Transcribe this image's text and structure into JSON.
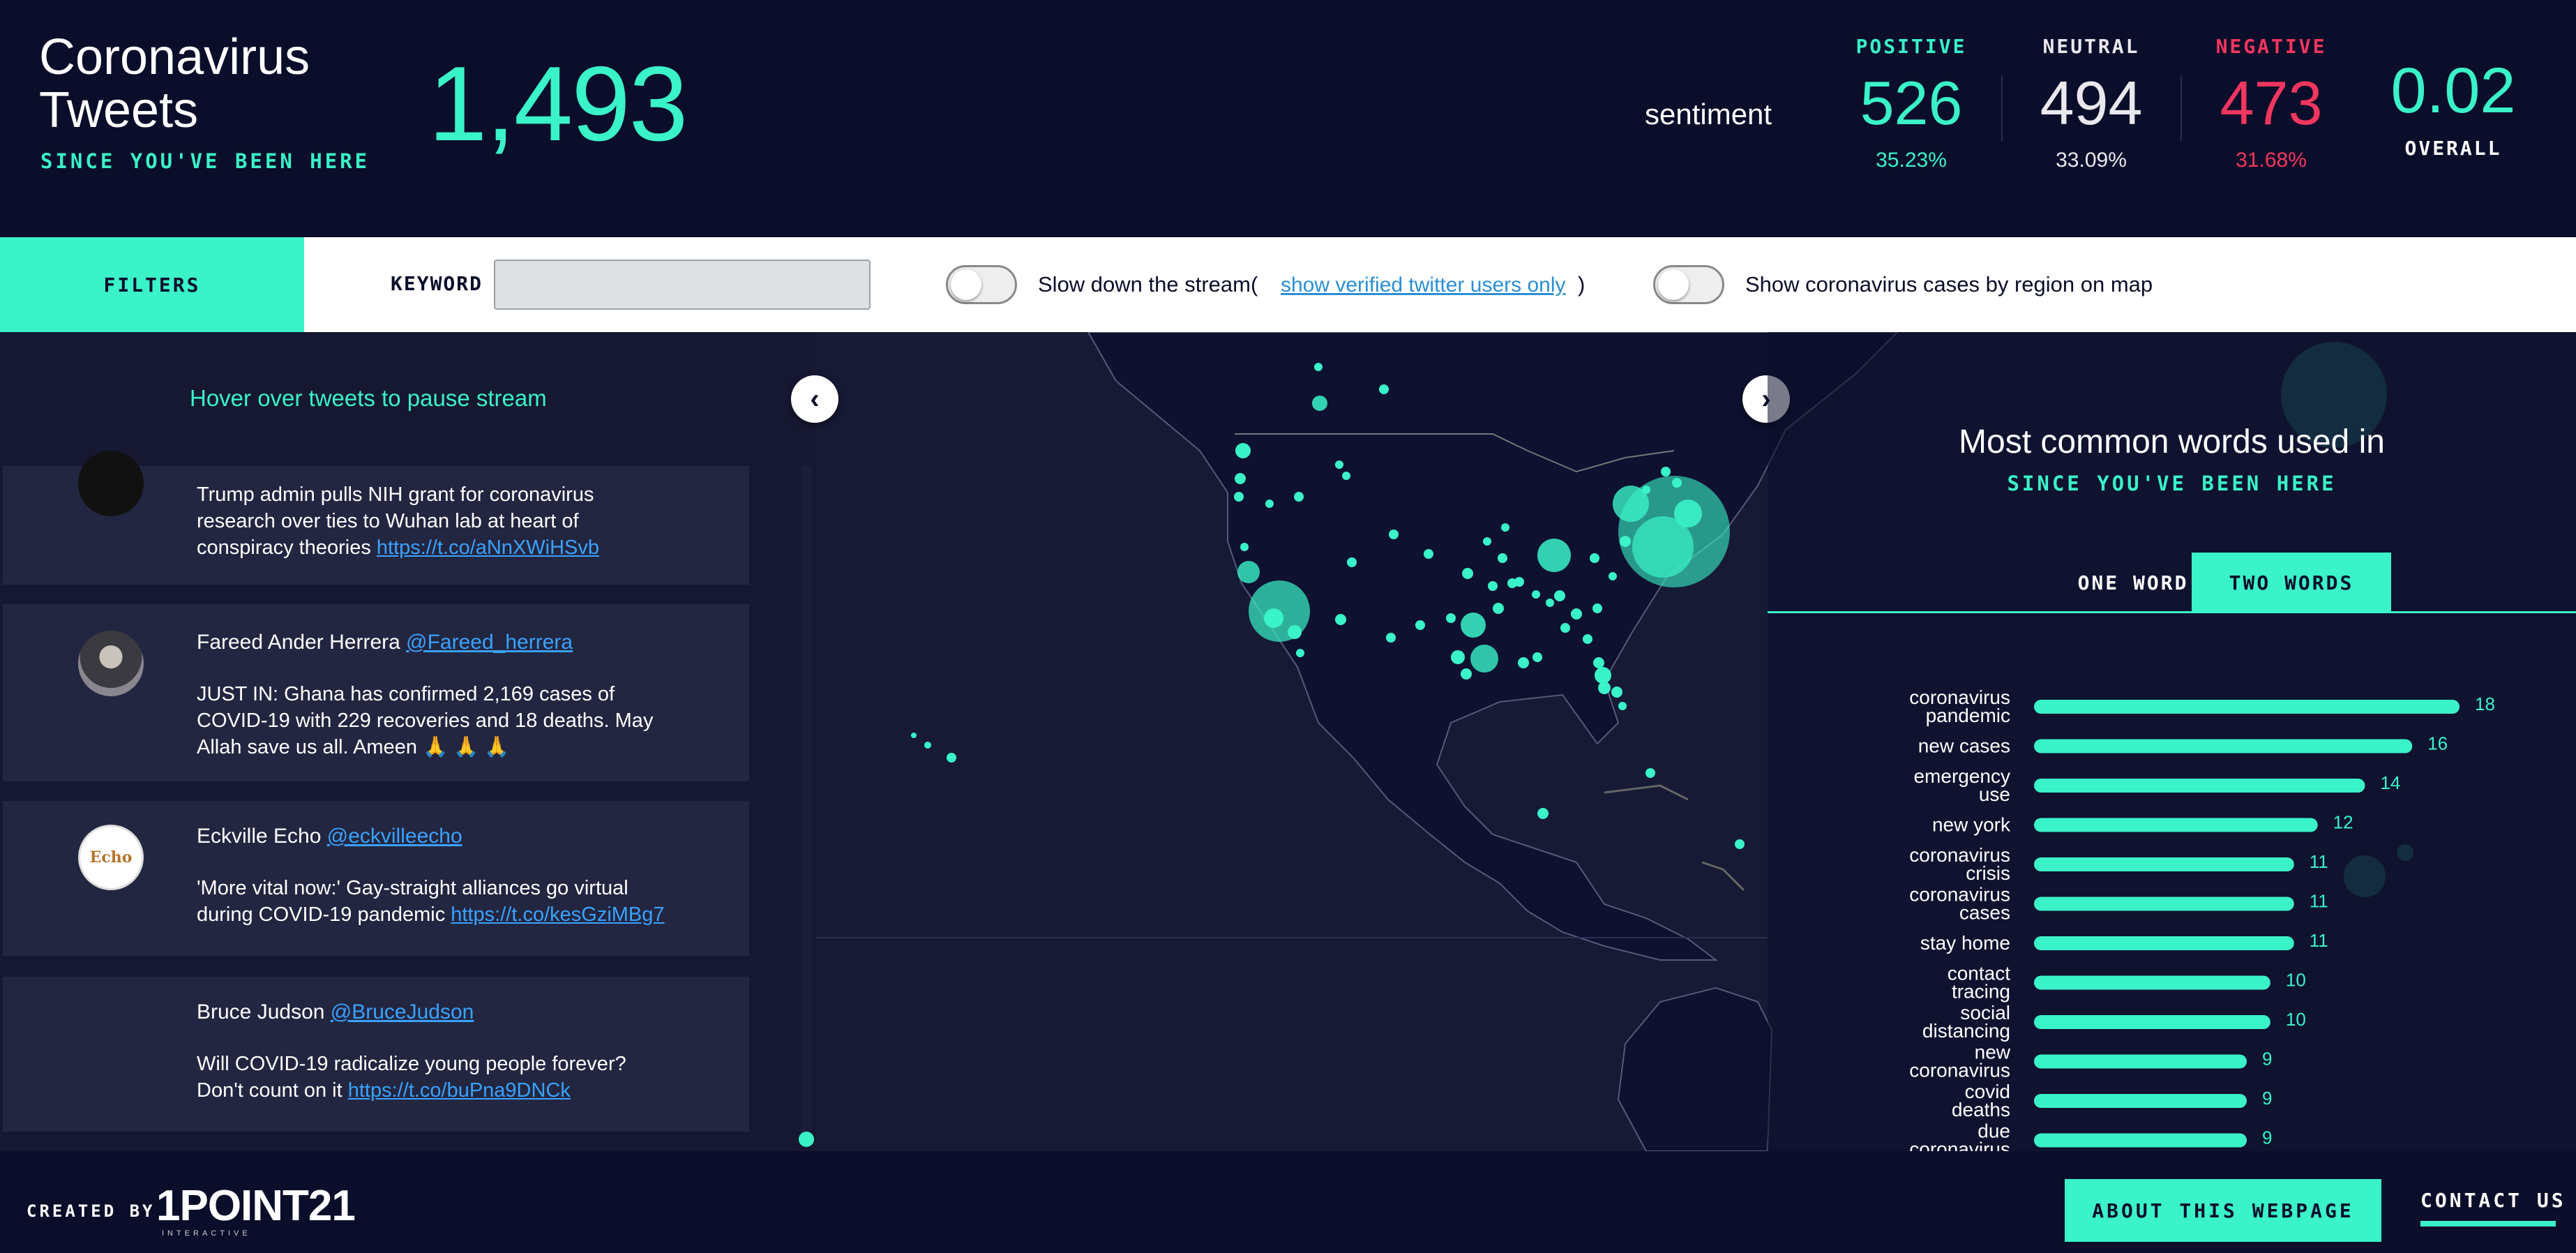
{
  "header": {
    "title": "Coronavirus Tweets",
    "subtitle": "SINCE YOU'VE BEEN HERE",
    "tweet_count": "1,493",
    "sentiment_label": "sentiment",
    "positive": {
      "label": "POSITIVE",
      "count": "526",
      "percent": "35.23%"
    },
    "neutral": {
      "label": "NEUTRAL",
      "count": "494",
      "percent": "33.09%"
    },
    "negative": {
      "label": "NEGATIVE",
      "count": "473",
      "percent": "31.68%"
    },
    "overall": {
      "value": "0.02",
      "label": "OVERALL"
    }
  },
  "filters": {
    "button_label": "FILTERS",
    "keyword_label": "KEYWORD",
    "keyword_value": "",
    "slow_label": "Slow down the stream(",
    "verified_link": "show verified twitter users only",
    "paren_close": ")",
    "cases_label": "Show coronavirus cases by region on map",
    "slow_enabled": false,
    "cases_enabled": false
  },
  "tweets": {
    "hint": "Hover over tweets to pause stream",
    "items": [
      {
        "author": "",
        "handle": "",
        "text": "Trump admin pulls NIH grant for coronavirus research over ties to Wuhan lab at heart of conspiracy theories ",
        "link": "https://t.co/aNnXWiHSvb"
      },
      {
        "author": "Fareed Ander Herrera ",
        "handle": "@Fareed_herrera",
        "text": "JUST IN: Ghana has confirmed 2,169 cases of COVID-19 with 229 recoveries and 18 deaths. May Allah save us all. Ameen 🙏 🙏 🙏",
        "link": ""
      },
      {
        "author": "Eckville Echo ",
        "handle": "@eckvilleecho",
        "text": "'More vital now:' Gay-straight alliances go virtual during COVID-19 pandemic ",
        "link": "https://t.co/kesGziMBg7"
      },
      {
        "author": "Bruce Judson ",
        "handle": "@BruceJudson",
        "text": "Will COVID-19 radicalize young people forever? Don't count on it ",
        "link": "https://t.co/buPna9DNCk"
      }
    ]
  },
  "words": {
    "title": "Most common words used in",
    "subtitle": "SINCE YOU'VE BEEN HERE",
    "tab_one": "ONE WORD",
    "tab_two": "TWO WORDS",
    "active_tab": "TWO WORDS"
  },
  "chart_data": {
    "type": "bar",
    "orientation": "horizontal",
    "categories": [
      "coronavirus pandemic",
      "new cases",
      "emergency use",
      "new york",
      "coronavirus crisis",
      "coronavirus cases",
      "stay home",
      "contact tracing",
      "social distancing",
      "new coronavirus",
      "covid deaths",
      "due coronavirus"
    ],
    "values": [
      18,
      16,
      14,
      12,
      11,
      11,
      11,
      10,
      10,
      9,
      9,
      9
    ],
    "color": "#3af3c8",
    "title": "",
    "xlabel": "",
    "ylabel": ""
  },
  "footer": {
    "created_by": "CREATED BY",
    "logo": "1POINT21",
    "logo_sub": "INTERACTIVE",
    "about": "ABOUT THIS WEBPAGE",
    "contact": "CONTACT US"
  },
  "colors": {
    "accent": "#3af3c8",
    "negative": "#f3365f",
    "background": "#0b0e2a",
    "link": "#3aa2ff"
  }
}
